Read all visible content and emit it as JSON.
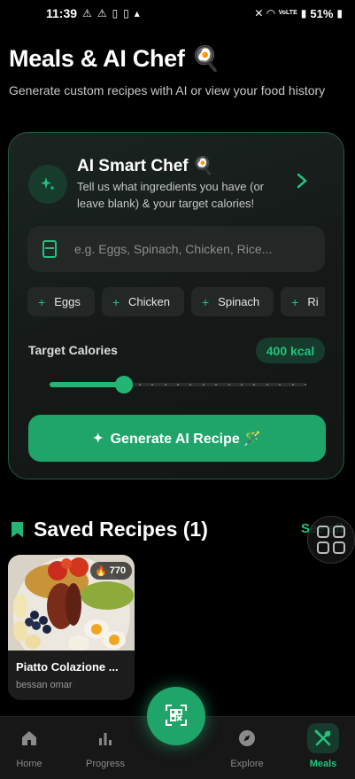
{
  "status_bar": {
    "time": "11:39",
    "battery": "51%",
    "network": "VoLTE"
  },
  "header": {
    "title": "Meals & AI Chef 🍳",
    "subtitle": "Generate custom recipes with AI or view your food history"
  },
  "ai_chef": {
    "title": "AI Smart Chef 🍳",
    "description": "Tell us what ingredients you have (or leave blank) & your target calories!",
    "ingredients_placeholder": "e.g. Eggs, Spinach, Chicken, Rice...",
    "chips": [
      "Eggs",
      "Chicken",
      "Spinach",
      "Ri"
    ],
    "target_calories_label": "Target Calories",
    "target_calories_value": "400 kcal",
    "slider_fraction": 0.29,
    "generate_label": "Generate AI Recipe 🪄",
    "accent_color": "#22c27e"
  },
  "saved": {
    "title": "Saved Recipes (1)",
    "see_all": "See all",
    "recipes": [
      {
        "name": "Piatto Colazione ...",
        "author": "bessan omar",
        "kcal": "770"
      }
    ]
  },
  "nav": {
    "items": [
      {
        "label": "Home",
        "icon": "home-icon"
      },
      {
        "label": "Progress",
        "icon": "bar-chart-icon"
      },
      {
        "label": "Explore",
        "icon": "compass-icon"
      },
      {
        "label": "Meals",
        "icon": "utensils-icon",
        "active": true
      }
    ],
    "center_icon": "qr-scan-icon"
  }
}
